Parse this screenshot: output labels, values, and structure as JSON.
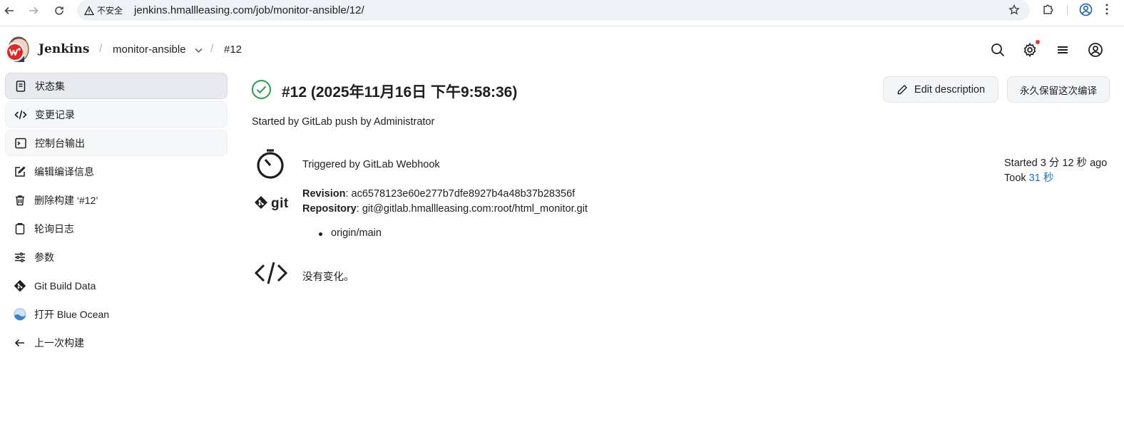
{
  "browser": {
    "security_label": "不安全",
    "url": "jenkins.hmallleasing.com/job/monitor-ansible/12/"
  },
  "header": {
    "brand": "Jenkins",
    "breadcrumbs": [
      {
        "label": "monitor-ansible"
      },
      {
        "label": "#12"
      }
    ]
  },
  "sidebar": {
    "items": [
      {
        "label": "状态集",
        "icon": "document-icon",
        "state": "active"
      },
      {
        "label": "变更记录",
        "icon": "code-icon",
        "state": "soft"
      },
      {
        "label": "控制台输出",
        "icon": "terminal-icon",
        "state": "soft"
      },
      {
        "label": "编辑编译信息",
        "icon": "edit-icon",
        "state": "normal"
      },
      {
        "label": "删除构建 ‘#12’",
        "icon": "trash-icon",
        "state": "normal"
      },
      {
        "label": "轮询日志",
        "icon": "clipboard-icon",
        "state": "normal"
      },
      {
        "label": "参数",
        "icon": "sliders-icon",
        "state": "normal"
      },
      {
        "label": "Git Build Data",
        "icon": "git-icon",
        "state": "normal"
      },
      {
        "label": "打开 Blue Ocean",
        "icon": "blue-ocean-icon",
        "state": "normal"
      },
      {
        "label": "上一次构建",
        "icon": "arrow-left-icon",
        "state": "normal"
      }
    ]
  },
  "main": {
    "title": "#12 (2025年11月16日 下午9:58:36)",
    "status": "success",
    "status_color": "#1ea446",
    "edit_button": "Edit description",
    "keep_button": "永久保留这次编译",
    "started_by": "Started by GitLab push by Administrator",
    "trigger": "Triggered by GitLab Webhook",
    "git_word": "git",
    "revision_label": "Revision",
    "revision_value": "ac6578123e60e277b7dfe8927b4a48b37b28356f",
    "repository_label": "Repository",
    "repository_value": "git@gitlab.hmallleasing.com:root/html_monitor.git",
    "branches": [
      "origin/main"
    ],
    "changes": "没有变化。",
    "started_ago": "Started 3 分 12 秒 ago",
    "took_prefix": "Took",
    "took_value": "31 秒"
  }
}
